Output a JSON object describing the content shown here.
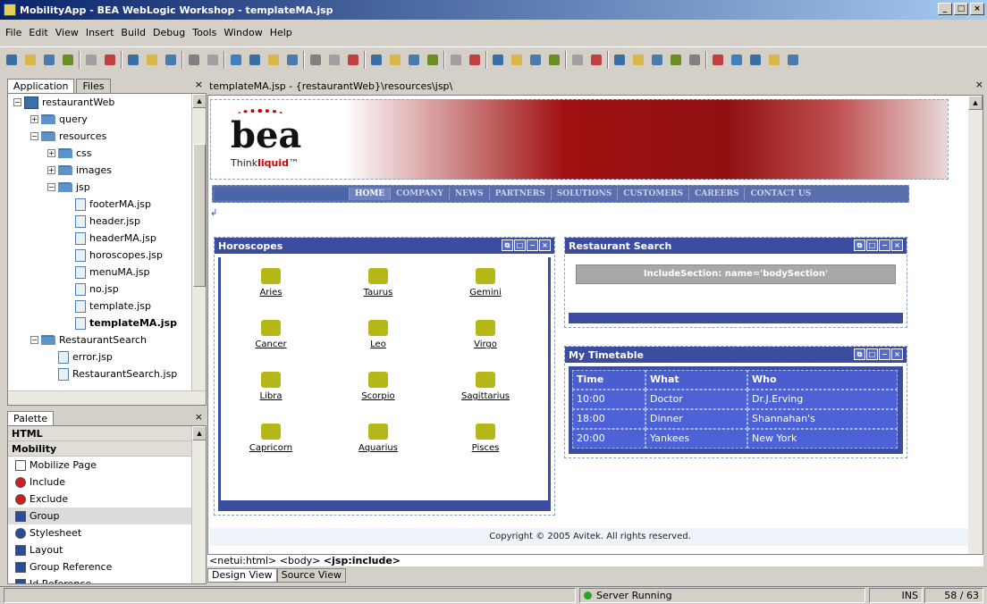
{
  "window": {
    "title": "MobilityApp - BEA WebLogic Workshop - templateMA.jsp"
  },
  "menu": [
    "File",
    "Edit",
    "View",
    "Insert",
    "Build",
    "Debug",
    "Tools",
    "Window",
    "Help"
  ],
  "left_panel": {
    "tabs": [
      "Application",
      "Files"
    ],
    "close": "×",
    "tree": [
      {
        "label": "restaurantWeb",
        "type": "project",
        "depth": 0,
        "exp": "−"
      },
      {
        "label": "query",
        "type": "folder",
        "depth": 1,
        "exp": "+"
      },
      {
        "label": "resources",
        "type": "folder",
        "depth": 1,
        "exp": "−"
      },
      {
        "label": "css",
        "type": "folder",
        "depth": 2,
        "exp": "+"
      },
      {
        "label": "images",
        "type": "folder",
        "depth": 2,
        "exp": "+"
      },
      {
        "label": "jsp",
        "type": "folder",
        "depth": 2,
        "exp": "−"
      },
      {
        "label": "footerMA.jsp",
        "type": "file",
        "depth": 3
      },
      {
        "label": "header.jsp",
        "type": "file",
        "depth": 3
      },
      {
        "label": "headerMA.jsp",
        "type": "file",
        "depth": 3
      },
      {
        "label": "horoscopes.jsp",
        "type": "file",
        "depth": 3
      },
      {
        "label": "menuMA.jsp",
        "type": "file",
        "depth": 3
      },
      {
        "label": "no.jsp",
        "type": "file",
        "depth": 3
      },
      {
        "label": "template.jsp",
        "type": "file",
        "depth": 3
      },
      {
        "label": "templateMA.jsp",
        "type": "file",
        "depth": 3,
        "bold": true
      },
      {
        "label": "RestaurantSearch",
        "type": "folder",
        "depth": 1,
        "exp": "−"
      },
      {
        "label": "error.jsp",
        "type": "file",
        "depth": 2
      },
      {
        "label": "RestaurantSearch.jsp",
        "type": "file",
        "depth": 2
      }
    ]
  },
  "palette": {
    "title": "Palette",
    "close": "×",
    "categories": [
      {
        "label": "HTML"
      },
      {
        "label": "Mobility"
      }
    ],
    "items": [
      {
        "label": "Mobilize Page",
        "icon": "page-icon",
        "color": "#ffffff"
      },
      {
        "label": "Include",
        "icon": "include-icon",
        "color": "#cc2020"
      },
      {
        "label": "Exclude",
        "icon": "exclude-icon",
        "color": "#cc2020"
      },
      {
        "label": "Group",
        "icon": "group-icon",
        "color": "#2a4a9a",
        "selected": true
      },
      {
        "label": "Stylesheet",
        "icon": "stylesheet-icon",
        "color": "#2a4a9a"
      },
      {
        "label": "Layout",
        "icon": "layout-icon",
        "color": "#2a4a9a"
      },
      {
        "label": "Group Reference",
        "icon": "group-reference-icon",
        "color": "#2a4a9a"
      },
      {
        "label": "Id Reference",
        "icon": "id-reference-icon",
        "color": "#2a4a9a"
      }
    ]
  },
  "editor": {
    "tab": "templateMA.jsp - {restaurantWeb}\\resources\\jsp\\",
    "close": "×",
    "banner": {
      "logo": "bea",
      "tagline_think": "Think",
      "tagline_liquid": "liquid",
      "tm": "™"
    },
    "nav": [
      "HOME",
      "COMPANY",
      "NEWS",
      "PARTNERS",
      "SOLUTIONS",
      "CUSTOMERS",
      "CAREERS",
      "CONTACT US"
    ],
    "horoscopes": {
      "title": "Horoscopes",
      "signs": [
        "Aries",
        "Taurus",
        "Gemini",
        "Cancer",
        "Leo",
        "Virgo",
        "Libra",
        "Scorpio",
        "Sagittarius",
        "Capricorn",
        "Aquarius",
        "Pisces"
      ]
    },
    "search": {
      "title": "Restaurant Search",
      "include": "IncludeSection: name='bodySection'"
    },
    "timetable": {
      "title": "My Timetable",
      "headers": [
        "Time",
        "What",
        "Who"
      ],
      "rows": [
        [
          "10:00",
          "Doctor",
          "Dr.J.Erving"
        ],
        [
          "18:00",
          "Dinner",
          "Shannahan's"
        ],
        [
          "20:00",
          "Yankees",
          "New York"
        ]
      ]
    },
    "copyright": "Copyright © 2005 Avitek. All rights reserved.",
    "breadcrumb_pre": "<netui:html> <body> ",
    "breadcrumb_bold": "<jsp:include>",
    "view_tabs": [
      "Design View",
      "Source View"
    ]
  },
  "status": {
    "server": "Server Running",
    "mode": "INS",
    "position": "58 / 63"
  }
}
